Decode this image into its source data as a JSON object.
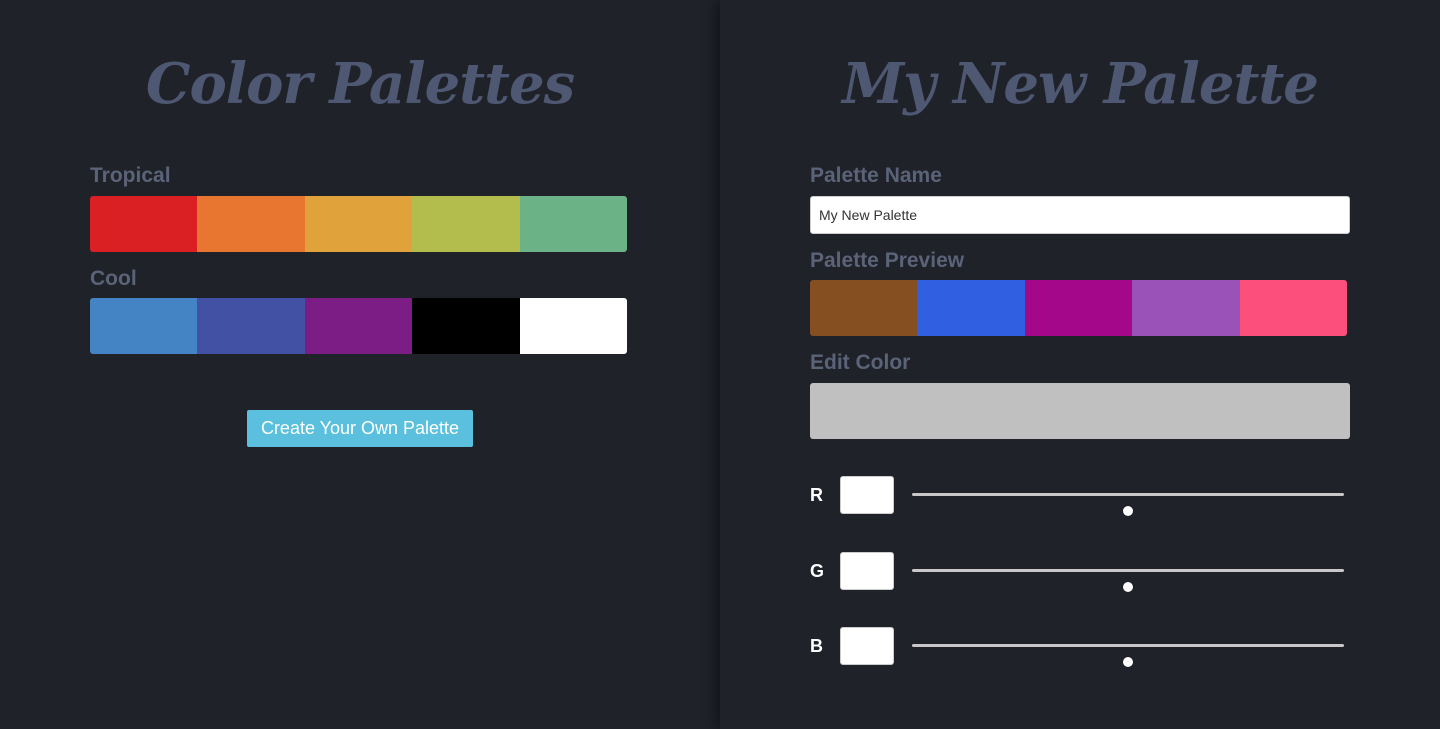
{
  "left": {
    "title": "Color Palettes",
    "palettes": [
      {
        "name": "Tropical",
        "colors": [
          "#da2022",
          "#e87630",
          "#e0a33b",
          "#b2bd4e",
          "#6bb286"
        ]
      },
      {
        "name": "Cool",
        "colors": [
          "#4484c4",
          "#4251a4",
          "#7b1d85",
          "#000000",
          "#ffffff"
        ]
      }
    ],
    "create_button_label": "Create Your Own Palette"
  },
  "right": {
    "title": "My New Palette",
    "name_label": "Palette Name",
    "name_value": "My New Palette",
    "preview_label": "Palette Preview",
    "preview_colors": [
      "#864f22",
      "#315fe2",
      "#a5078b",
      "#9a52b8",
      "#fc4f7b"
    ],
    "edit_label": "Edit Color",
    "edit_color": "#c0c0c0",
    "channels": [
      {
        "letter": "R",
        "value": "",
        "level": 0.5
      },
      {
        "letter": "G",
        "value": "",
        "level": 0.5
      },
      {
        "letter": "B",
        "value": "",
        "level": 0.5
      }
    ]
  },
  "colors": {
    "background": "#1f2229",
    "title_color": "#4f5872",
    "label_color": "#5b6378",
    "accent_button": "#5bc0de"
  }
}
